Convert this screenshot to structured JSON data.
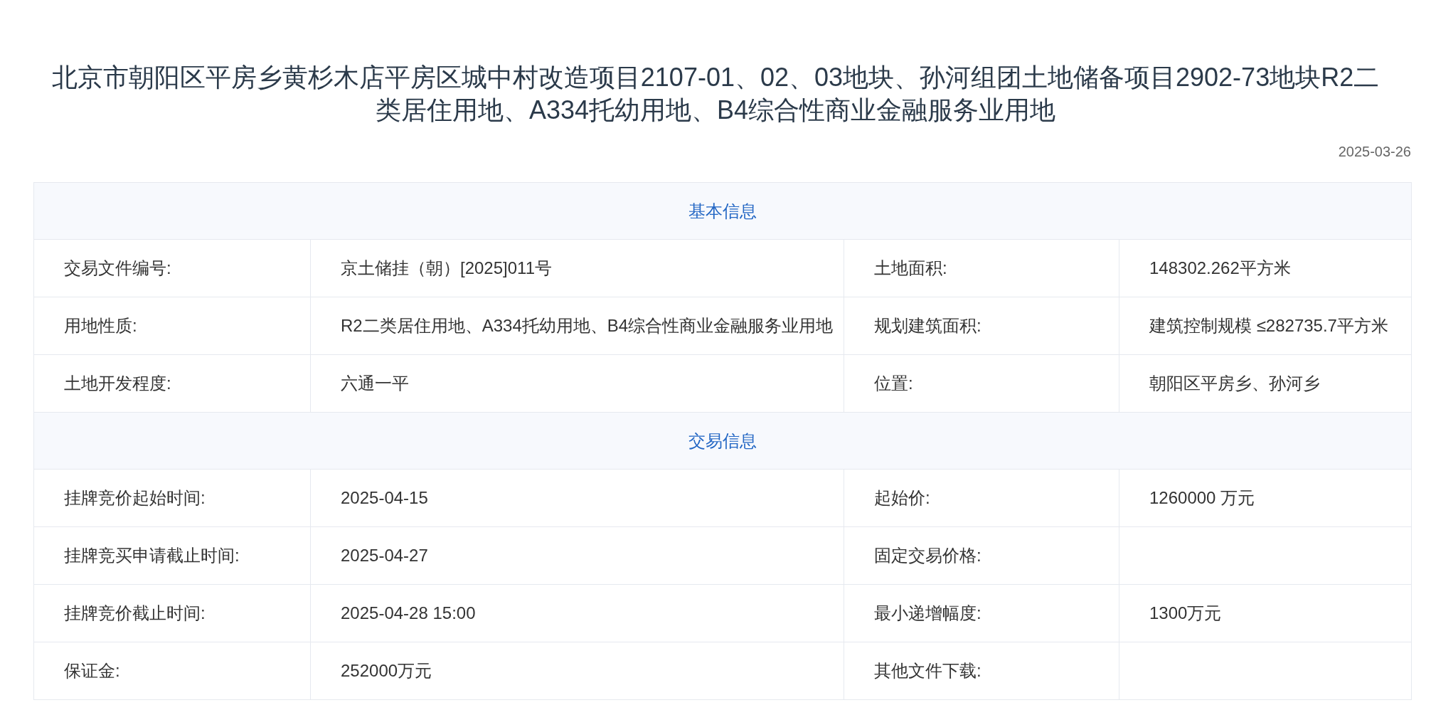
{
  "title": "北京市朝阳区平房乡黄杉木店平房区城中村改造项目2107-01、02、03地块、孙河组团土地储备项目2902-73地块R2二类居住用地、A334托幼用地、B4综合性商业金融服务业用地",
  "date": "2025-03-26",
  "sections": [
    {
      "heading": "基本信息",
      "rows": [
        {
          "label": "交易文件编号:",
          "value": "京土储挂（朝）[2025]011号",
          "label2": "土地面积:",
          "value2": "148302.262平方米"
        },
        {
          "label": "用地性质:",
          "value": "R2二类居住用地、A334托幼用地、B4综合性商业金融服务业用地",
          "label2": "规划建筑面积:",
          "value2": "建筑控制规模 ≤282735.7平方米"
        },
        {
          "label": "土地开发程度:",
          "value": "六通一平",
          "label2": "位置:",
          "value2": "朝阳区平房乡、孙河乡"
        }
      ]
    },
    {
      "heading": "交易信息",
      "rows": [
        {
          "label": "挂牌竞价起始时间:",
          "value": "2025-04-15",
          "label2": "起始价:",
          "value2": "1260000 万元"
        },
        {
          "label": "挂牌竞买申请截止时间:",
          "value": "2025-04-27",
          "label2": "固定交易价格:"
        },
        {
          "label": "挂牌竞价截止时间:",
          "value": "2025-04-28 15:00",
          "label2": "最小递增幅度:",
          "value2": "1300万元"
        },
        {
          "label": "保证金:",
          "value": "252000万元",
          "label2": "其他文件下载:"
        }
      ]
    }
  ]
}
